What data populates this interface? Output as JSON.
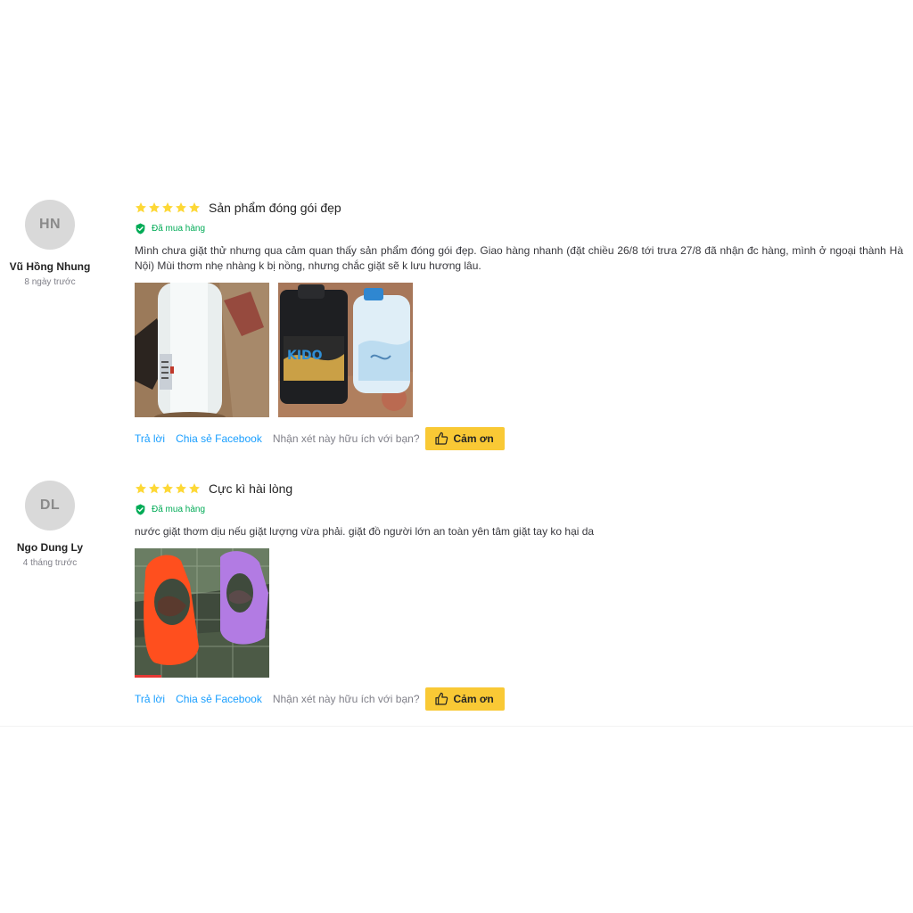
{
  "colors": {
    "star": "#fdd836",
    "verified": "#00ab56",
    "link": "#189eff",
    "button": "#f9c935"
  },
  "reviews": [
    {
      "avatar_initials": "HN",
      "author": "Vũ Hồng Nhung",
      "time": "8 ngày trước",
      "rating": 5,
      "title": "Sản phẩm đóng gói đẹp",
      "verified_label": "Đã mua hàng",
      "text": "Mình chưa giặt thử nhưng qua cảm quan thấy sản phẩm đóng gói đẹp. Giao hàng nhanh (đặt chiều 26/8 tới trưa 27/8 đã nhận đc hàng, mình ở ngoại thành Hà Nội) Mùi thơm nhẹ nhàng k bị nồng, nhưng chắc giặt sẽ k lưu hương lâu.",
      "photos": [
        {
          "icon": "white-detergent-bottle-photo",
          "kido_text": ""
        },
        {
          "icon": "kido-detergent-cans-photo",
          "kido_text": "KIDO"
        }
      ],
      "reply_label": "Trả lời",
      "share_label": "Chia sẻ Facebook",
      "helpful_question": "Nhận xét này hữu ích với bạn?",
      "thanks_label": "Cảm ơn"
    },
    {
      "avatar_initials": "DL",
      "author": "Ngo Dung Ly",
      "time": "4 tháng trước",
      "rating": 5,
      "title": "Cực kì hài lòng",
      "verified_label": "Đã mua hàng",
      "text": "nước giặt thơm dịu nếu giặt lượng vừa phải. giặt đồ người lớn an toàn yên tâm giặt tay ko hại da",
      "photos": [
        {
          "icon": "bottle-planter-photo"
        }
      ],
      "reply_label": "Trả lời",
      "share_label": "Chia sẻ Facebook",
      "helpful_question": "Nhận xét này hữu ích với bạn?",
      "thanks_label": "Cảm ơn"
    }
  ]
}
